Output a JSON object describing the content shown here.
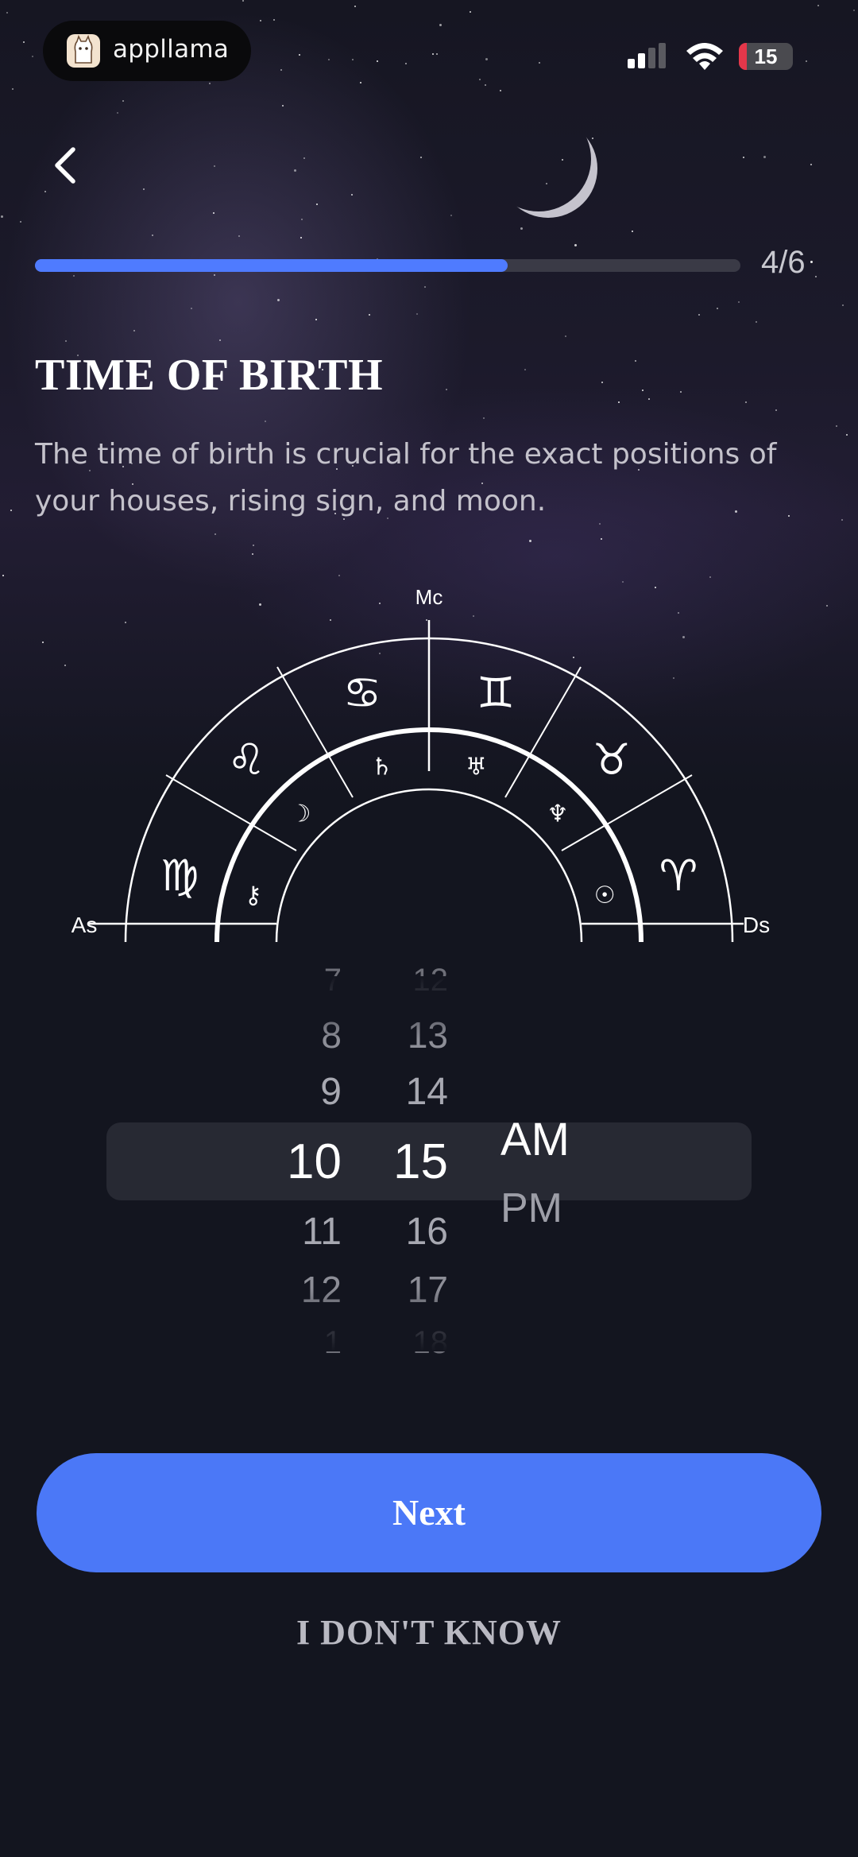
{
  "status_bar": {
    "app_name": "appllama",
    "battery": "15"
  },
  "header": {
    "progress_label": "4/6",
    "progress_value": 0.67
  },
  "content": {
    "title": "TIME OF BIRTH",
    "subtitle": "The time of birth is crucial for the exact positions of your houses, rising sign, and moon."
  },
  "chart": {
    "labels": {
      "top": "Mc",
      "left": "As",
      "right": "Ds"
    },
    "zodiac_signs": [
      "♍",
      "♌",
      "♋",
      "♊",
      "♉",
      "♈"
    ],
    "planets": [
      "⚷",
      "☽",
      "♄",
      "♅",
      "♆",
      "☉"
    ]
  },
  "time_picker": {
    "hours": [
      "7",
      "8",
      "9",
      "10",
      "11",
      "12",
      "1"
    ],
    "minutes": [
      "12",
      "13",
      "14",
      "15",
      "16",
      "17",
      "18"
    ],
    "periods": [
      "AM",
      "PM"
    ],
    "selected": {
      "hour": "10",
      "minute": "15",
      "period": "AM"
    }
  },
  "actions": {
    "next_label": "Next",
    "dont_know_label": "I DON'T KNOW"
  },
  "colors": {
    "accent": "#4b78f7",
    "background": "#13151f",
    "highlight": "#272933"
  }
}
